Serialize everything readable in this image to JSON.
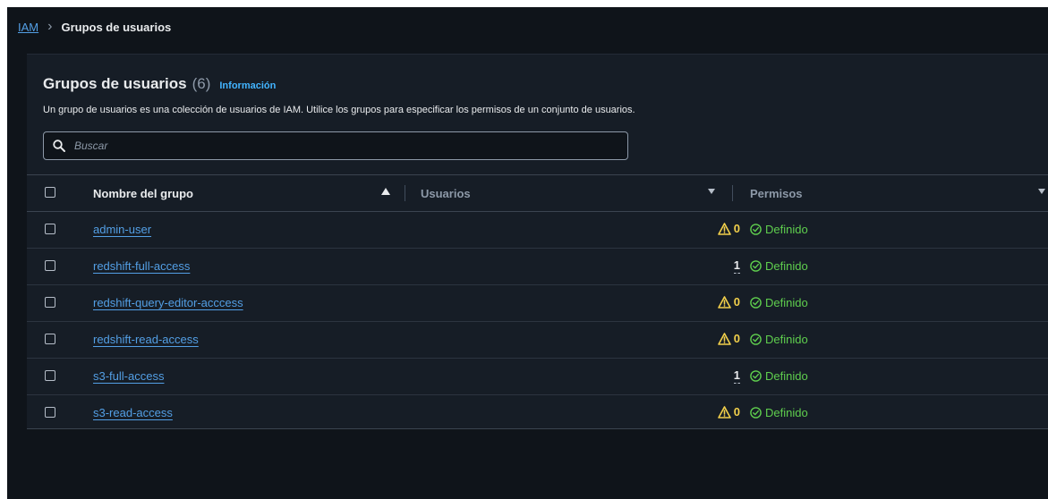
{
  "breadcrumb": {
    "root": "IAM",
    "separator": ">",
    "current": "Grupos de usuarios"
  },
  "header": {
    "title": "Grupos de usuarios",
    "count": "(6)",
    "info_link": "Información",
    "description": "Un grupo de usuarios es una colección de usuarios de IAM. Utilice los grupos para especificar los permisos de un conjunto de usuarios."
  },
  "search": {
    "placeholder": "Buscar",
    "value": "",
    "icon": "search-icon"
  },
  "table": {
    "columns": {
      "name": "Nombre del grupo",
      "users": "Usuarios",
      "permissions": "Permisos"
    },
    "sort": {
      "column": "name",
      "direction": "ascending"
    },
    "rows": [
      {
        "name": "admin-user",
        "users": "0",
        "users_warning": true,
        "permissions": "Definido"
      },
      {
        "name": "redshift-full-access",
        "users": "1",
        "users_warning": false,
        "permissions": "Definido"
      },
      {
        "name": "redshift-query-editor-acccess",
        "users": "0",
        "users_warning": true,
        "permissions": "Definido"
      },
      {
        "name": "redshift-read-access",
        "users": "0",
        "users_warning": true,
        "permissions": "Definido"
      },
      {
        "name": "s3-full-access",
        "users": "1",
        "users_warning": false,
        "permissions": "Definido"
      },
      {
        "name": "s3-read-access",
        "users": "0",
        "users_warning": true,
        "permissions": "Definido"
      }
    ]
  },
  "colors": {
    "background": "#0f141a",
    "panel": "#161d26",
    "link": "#539fe5",
    "info": "#42b4ff",
    "warning": "#f2d04b",
    "success": "#5fce4e"
  }
}
